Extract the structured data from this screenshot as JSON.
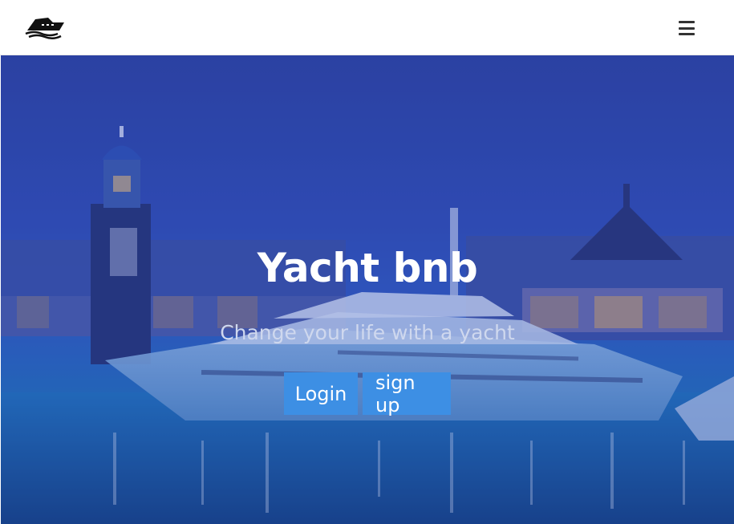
{
  "navbar": {
    "logo_icon": "yacht-logo-icon",
    "menu_icon": "hamburger-menu-icon"
  },
  "hero": {
    "title": "Yacht bnb",
    "subtitle": "Change your life with a yacht",
    "buttons": {
      "login_label": "Login",
      "signup_label": "sign up"
    }
  },
  "colors": {
    "button_bg": "#3d8fe4",
    "overlay": "#2e4bb0",
    "text": "#ffffff"
  }
}
